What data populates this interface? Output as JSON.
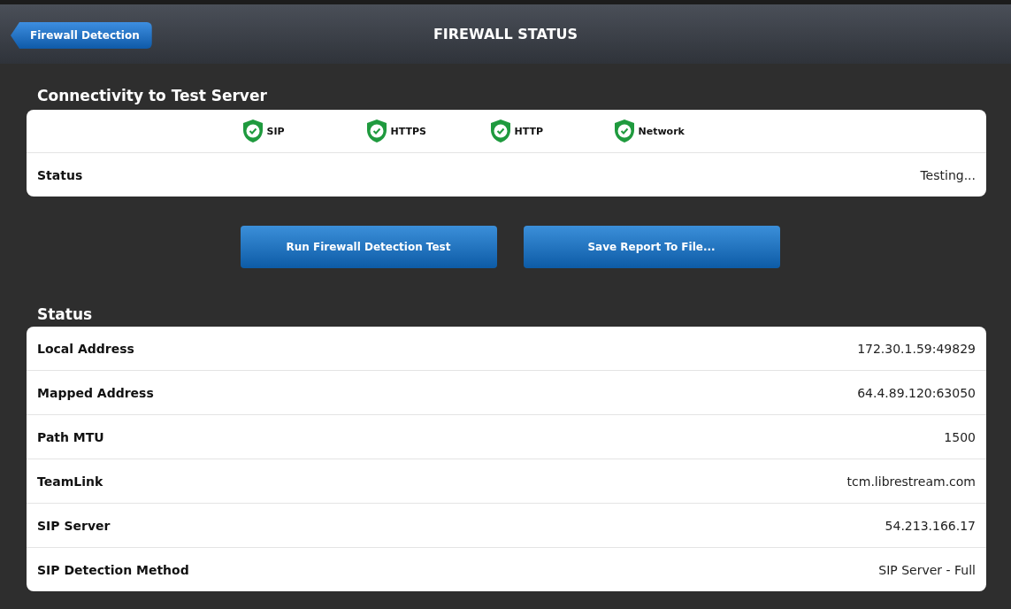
{
  "header": {
    "back_button": "Firewall Detection",
    "title": "FIREWALL STATUS"
  },
  "connectivity": {
    "heading": "Connectivity to Test Server",
    "checks": [
      {
        "label": "SIP",
        "passed": true
      },
      {
        "label": "HTTPS",
        "passed": true
      },
      {
        "label": "HTTP",
        "passed": true
      },
      {
        "label": "Network",
        "passed": true
      }
    ],
    "status_label": "Status",
    "status_value": "Testing..."
  },
  "buttons": [
    "Run Firewall Detection Test",
    "Save Report To File..."
  ],
  "status": {
    "heading": "Status",
    "rows": [
      {
        "label": "Local Address",
        "value": "172.30.1.59:49829"
      },
      {
        "label": "Mapped Address",
        "value": "64.4.89.120:63050"
      },
      {
        "label": "Path MTU",
        "value": "1500"
      },
      {
        "label": "TeamLink",
        "value": "tcm.librestream.com"
      },
      {
        "label": "SIP Server",
        "value": "54.213.166.17"
      },
      {
        "label": "SIP Detection Method",
        "value": "SIP Server - Full"
      }
    ]
  }
}
